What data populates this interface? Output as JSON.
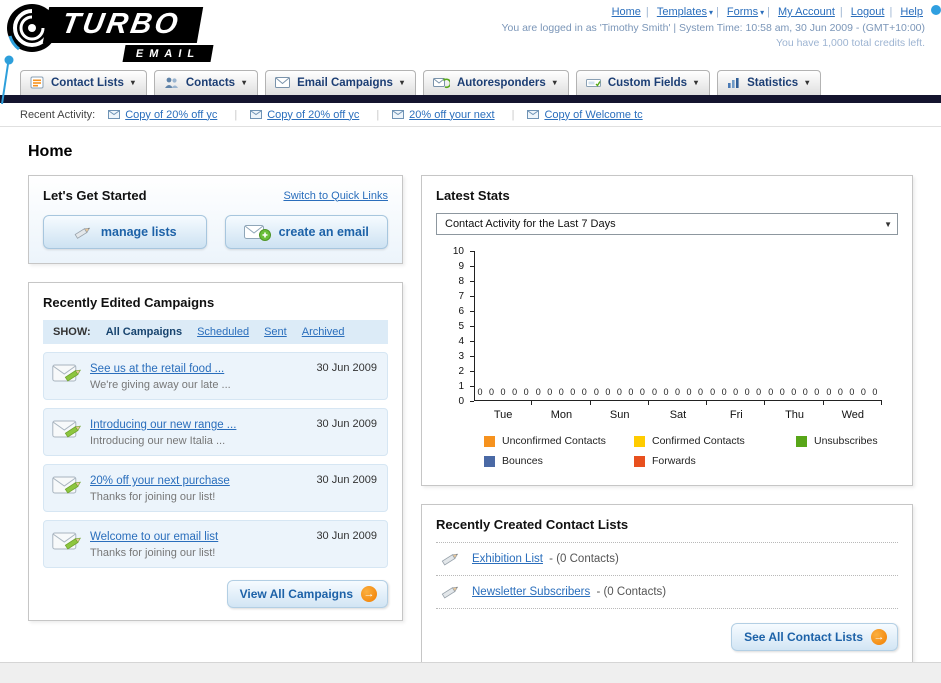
{
  "icons": {
    "caret_down": "▾",
    "select_arrow": "▼",
    "go_arrow": "→"
  },
  "header": {
    "logo_title": "TURBO",
    "logo_subtitle": "EMAIL",
    "nav_links": [
      "Home",
      "Templates",
      "Forms",
      "My Account",
      "Logout",
      "Help"
    ],
    "login_info": "You are logged in as 'Timothy Smith' | System Time: 10:58 am, 30 Jun 2009 - (GMT+10:00)",
    "credits_info": "You have 1,000 total credits left."
  },
  "nav_tabs": [
    {
      "label": "Contact Lists"
    },
    {
      "label": "Contacts"
    },
    {
      "label": "Email Campaigns"
    },
    {
      "label": "Autoresponders"
    },
    {
      "label": "Custom Fields"
    },
    {
      "label": "Statistics"
    }
  ],
  "recent_activity": {
    "label": "Recent Activity:",
    "items": [
      "Copy of 20% off yc",
      "Copy of 20% off yc",
      "20% off your next",
      "Copy of Welcome tc"
    ]
  },
  "page_title": "Home",
  "get_started": {
    "title": "Let's Get Started",
    "switch_link": "Switch to Quick Links",
    "manage_lists_label": "manage lists",
    "create_email_label": "create an email"
  },
  "campaigns": {
    "title": "Recently Edited Campaigns",
    "show_label": "SHOW:",
    "tabs": [
      "All Campaigns",
      "Scheduled",
      "Sent",
      "Archived"
    ],
    "active_tab": "All Campaigns",
    "items": [
      {
        "title": "See us at the retail food ...",
        "subtitle": "We're giving away our late ...",
        "date": "30 Jun 2009"
      },
      {
        "title": "Introducing our new range ...",
        "subtitle": "Introducing our new Italia ...",
        "date": "30 Jun 2009"
      },
      {
        "title": "20% off your next purchase",
        "subtitle": "Thanks for joining our list!",
        "date": "30 Jun 2009"
      },
      {
        "title": "Welcome to our email list",
        "subtitle": "Thanks for joining our list!",
        "date": "30 Jun 2009"
      }
    ],
    "view_all_label": "View All Campaigns"
  },
  "stats": {
    "title": "Latest Stats",
    "dropdown_value": "Contact Activity for the Last 7 Days",
    "chart_data": {
      "type": "bar",
      "title": "Contact Activity for the Last 7 Days",
      "categories": [
        "Tue",
        "Mon",
        "Sun",
        "Sat",
        "Fri",
        "Thu",
        "Wed"
      ],
      "series": [
        {
          "name": "Unconfirmed Contacts",
          "color": "#f6921e",
          "values": [
            0,
            0,
            0,
            0,
            0,
            0,
            0
          ]
        },
        {
          "name": "Confirmed Contacts",
          "color": "#ffcc00",
          "values": [
            0,
            0,
            0,
            0,
            0,
            0,
            0
          ]
        },
        {
          "name": "Unsubscribes",
          "color": "#58a618",
          "values": [
            0,
            0,
            0,
            0,
            0,
            0,
            0
          ]
        },
        {
          "name": "Bounces",
          "color": "#4a69a5",
          "values": [
            0,
            0,
            0,
            0,
            0,
            0,
            0
          ]
        },
        {
          "name": "Forwards",
          "color": "#e8501e",
          "values": [
            0,
            0,
            0,
            0,
            0,
            0,
            0
          ]
        }
      ],
      "ylim": [
        0,
        10
      ],
      "yticks": [
        0,
        1,
        2,
        3,
        4,
        5,
        6,
        7,
        8,
        9,
        10
      ],
      "legend_position": "bottom",
      "grid": false
    }
  },
  "contact_lists": {
    "title": "Recently Created Contact Lists",
    "items": [
      {
        "name": "Exhibition List",
        "detail": "- (0 Contacts)"
      },
      {
        "name": "Newsletter Subscribers",
        "detail": "- (0 Contacts)"
      }
    ],
    "see_all_label": "See All Contact Lists"
  }
}
